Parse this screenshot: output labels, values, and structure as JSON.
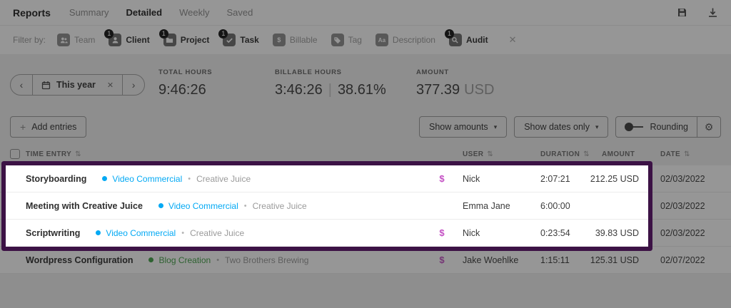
{
  "nav": {
    "brand": "Reports",
    "tabs": [
      {
        "label": "Summary"
      },
      {
        "label": "Detailed"
      },
      {
        "label": "Weekly"
      },
      {
        "label": "Saved"
      }
    ]
  },
  "filter": {
    "label": "Filter by:",
    "chips": [
      {
        "label": "Team",
        "badge": ""
      },
      {
        "label": "Client",
        "badge": "1"
      },
      {
        "label": "Project",
        "badge": "1"
      },
      {
        "label": "Task",
        "badge": "1"
      },
      {
        "label": "Billable",
        "badge": ""
      },
      {
        "label": "Tag",
        "badge": ""
      },
      {
        "label": "Description",
        "badge": ""
      },
      {
        "label": "Audit",
        "badge": "1"
      }
    ],
    "clear": "✕"
  },
  "period": {
    "prev": "‹",
    "label": "This year",
    "clear": "✕",
    "next": "›"
  },
  "stats": {
    "total": {
      "label": "TOTAL HOURS",
      "value": "9:46:26"
    },
    "billable": {
      "label": "BILLABLE HOURS",
      "value": "3:46:26",
      "divider": "|",
      "percent": "38.61%"
    },
    "amount": {
      "label": "AMOUNT",
      "value": "377.39",
      "currency": "USD"
    }
  },
  "toolbar": {
    "add": "Add entries",
    "show_amounts": "Show amounts",
    "show_dates": "Show dates only",
    "rounding": "Rounding"
  },
  "table": {
    "headers": {
      "entry": "TIME ENTRY",
      "user": "USER",
      "duration": "DURATION",
      "amount": "AMOUNT",
      "date": "DATE"
    },
    "rows": [
      {
        "entry": "Storyboarding",
        "project": "Video Commercial",
        "client": "Creative Juice",
        "billable": "$",
        "user": "Nick",
        "duration": "2:07:21",
        "amount": "212.25 USD",
        "date": "02/03/2022"
      },
      {
        "entry": "Meeting with Creative Juice",
        "project": "Video Commercial",
        "client": "Creative Juice",
        "billable": "",
        "user": "Emma Jane",
        "duration": "6:00:00",
        "amount": "",
        "date": "02/03/2022"
      },
      {
        "entry": "Scriptwriting",
        "project": "Video Commercial",
        "client": "Creative Juice",
        "billable": "$",
        "user": "Nick",
        "duration": "0:23:54",
        "amount": "39.83 USD",
        "date": "02/03/2022"
      },
      {
        "entry": "Wordpress Configuration",
        "project": "Blog Creation",
        "client": "Two Brothers Brewing",
        "billable": "$",
        "user": "Jake Woehlke",
        "duration": "1:15:11",
        "amount": "125.31 USD",
        "date": "02/07/2022"
      }
    ]
  },
  "icons": {
    "plus": "+",
    "caret_down": "▾",
    "sort": "⇅",
    "gear": "⚙",
    "bullet": "•"
  },
  "colors": {
    "project_blue": "#03a9f4",
    "project_green": "#43a047",
    "billable_pink": "#c44fc4",
    "highlight_purple": "#3c1245",
    "overlay": "rgba(22,22,22,0.45)"
  }
}
